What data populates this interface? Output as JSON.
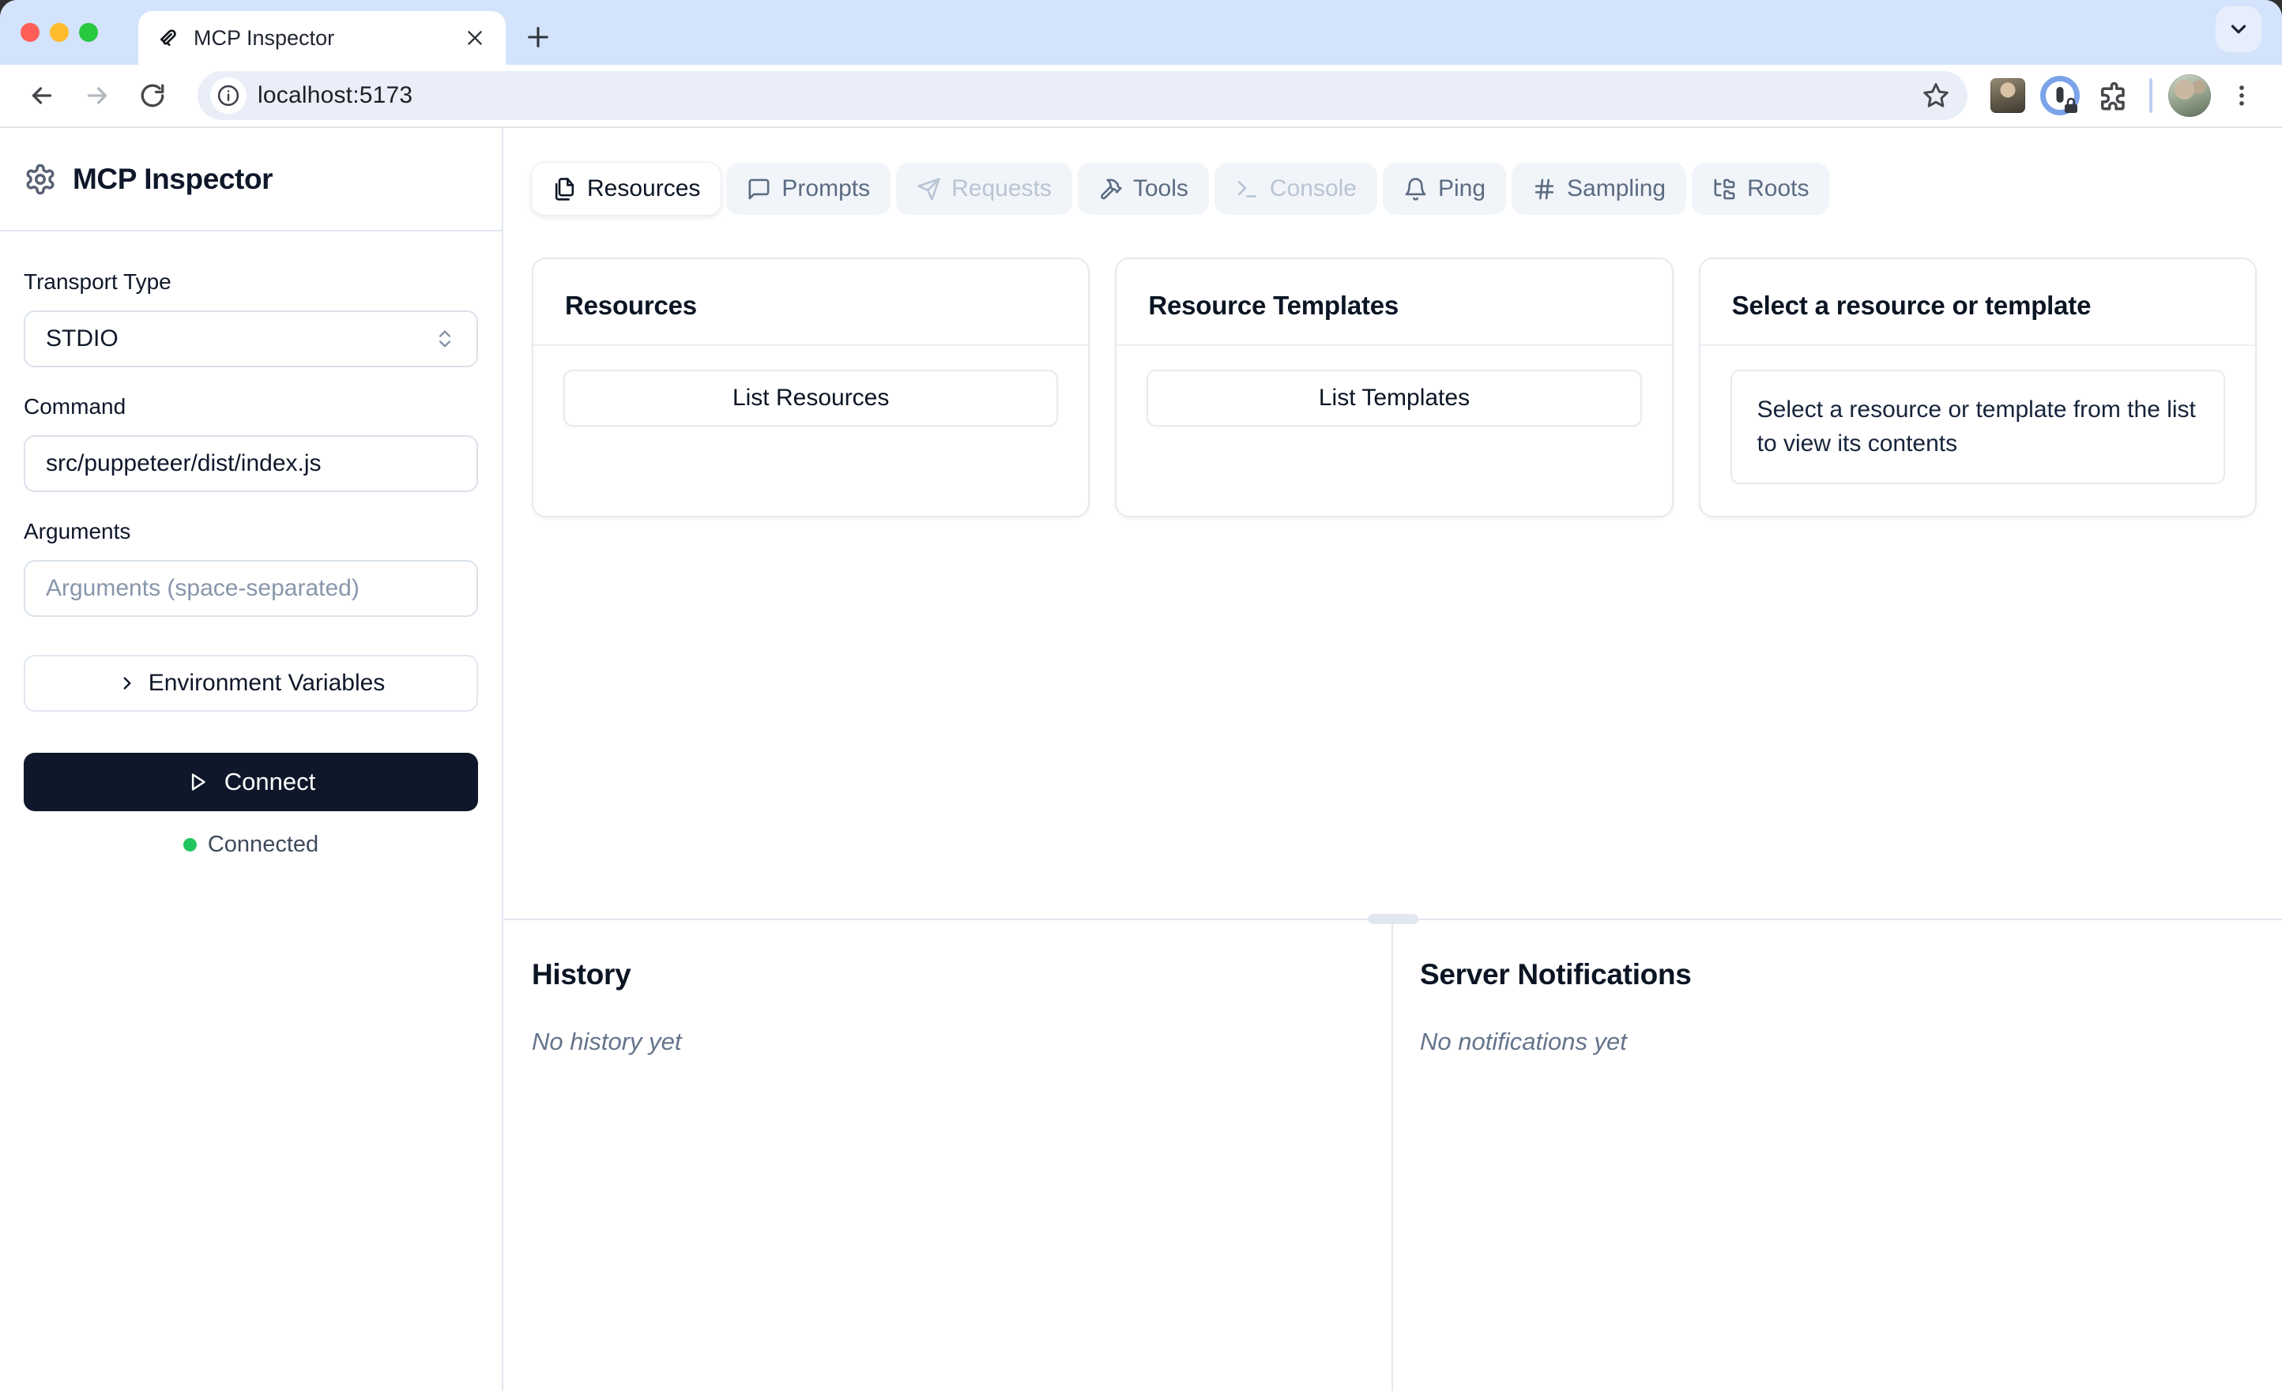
{
  "browser": {
    "tab_title": "MCP Inspector",
    "url": "localhost:5173"
  },
  "sidebar": {
    "title": "MCP Inspector",
    "transport_label": "Transport Type",
    "transport_value": "STDIO",
    "command_label": "Command",
    "command_value": "src/puppeteer/dist/index.js",
    "arguments_label": "Arguments",
    "arguments_placeholder": "Arguments (space-separated)",
    "env_button": "Environment Variables",
    "connect_button": "Connect",
    "status": "Connected"
  },
  "main": {
    "tabs": [
      {
        "label": "Resources",
        "icon": "files-icon",
        "state": "active"
      },
      {
        "label": "Prompts",
        "icon": "message-square-icon",
        "state": "enabled"
      },
      {
        "label": "Requests",
        "icon": "send-icon",
        "state": "disabled"
      },
      {
        "label": "Tools",
        "icon": "hammer-icon",
        "state": "enabled"
      },
      {
        "label": "Console",
        "icon": "terminal-icon",
        "state": "disabled"
      },
      {
        "label": "Ping",
        "icon": "bell-icon",
        "state": "enabled"
      },
      {
        "label": "Sampling",
        "icon": "hash-icon",
        "state": "enabled"
      },
      {
        "label": "Roots",
        "icon": "folder-tree-icon",
        "state": "enabled"
      }
    ],
    "cards": {
      "resources": {
        "title": "Resources",
        "button": "List Resources"
      },
      "templates": {
        "title": "Resource Templates",
        "button": "List Templates"
      },
      "preview": {
        "title": "Select a resource or template",
        "body": "Select a resource or template from the list to view its contents"
      }
    },
    "history": {
      "title": "History",
      "empty": "No history yet"
    },
    "notifications": {
      "title": "Server Notifications",
      "empty": "No notifications yet"
    }
  },
  "colors": {
    "accent_dark": "#0f172a",
    "status_green": "#22c55e",
    "tabstrip_blue": "#d4e3fc",
    "border": "#e2e8f0"
  }
}
